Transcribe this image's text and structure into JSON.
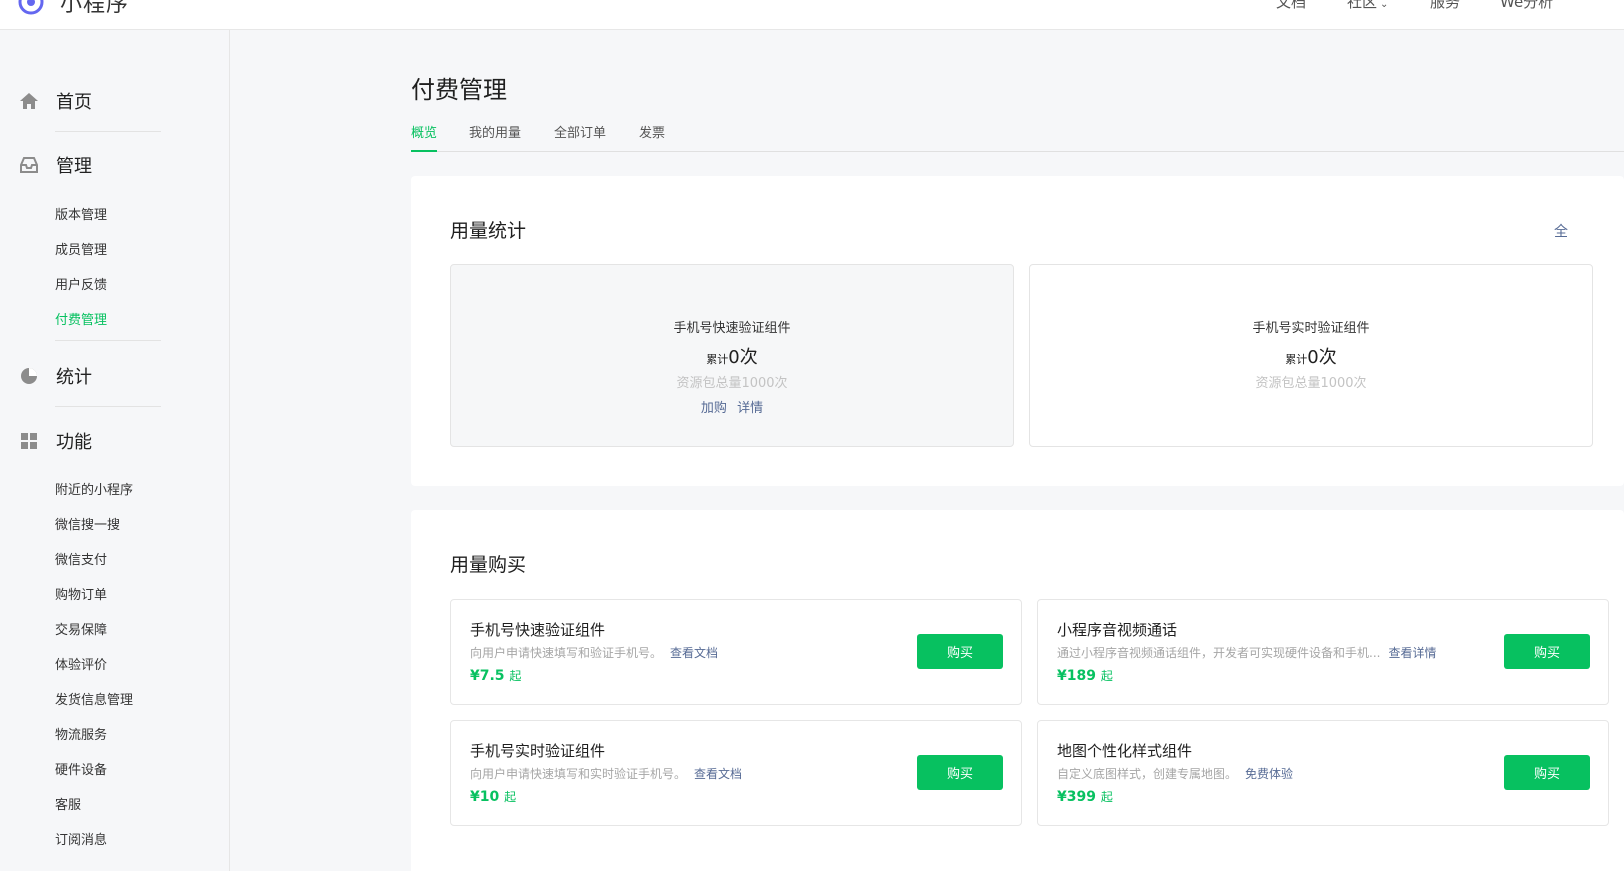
{
  "app": {
    "title": "小程序"
  },
  "topnav": [
    "文档",
    "社区",
    "服务",
    "We分析"
  ],
  "sidebar": {
    "groups": [
      {
        "label": "首页",
        "icon": "home-icon"
      },
      {
        "label": "管理",
        "icon": "inbox-icon",
        "items": [
          "版本管理",
          "成员管理",
          "用户反馈",
          "付费管理"
        ]
      },
      {
        "label": "统计",
        "icon": "pie-chart-icon"
      },
      {
        "label": "功能",
        "icon": "grid-icon",
        "items": [
          "附近的小程序",
          "微信搜一搜",
          "微信支付",
          "购物订单",
          "交易保障",
          "体验评价",
          "发货信息管理",
          "物流服务",
          "硬件设备",
          "客服",
          "订阅消息"
        ]
      }
    ],
    "active_item": "付费管理"
  },
  "page": {
    "title": "付费管理",
    "tabs": [
      "概览",
      "我的用量",
      "全部订单",
      "发票"
    ],
    "active_tab": "概览"
  },
  "usage": {
    "title": "用量统计",
    "link": "全",
    "cards": [
      {
        "name": "手机号快速验证组件",
        "prefix": "累计",
        "count": "0次",
        "total": "资源包总量1000次",
        "links": [
          "加购",
          "详情"
        ]
      },
      {
        "name": "手机号实时验证组件",
        "prefix": "累计",
        "count": "0次",
        "total": "资源包总量1000次"
      }
    ]
  },
  "purchase": {
    "title": "用量购买",
    "items": [
      {
        "name": "手机号快速验证组件",
        "desc": "向用户申请快速填写和验证手机号。",
        "link": "查看文档",
        "price": "¥7.5",
        "suffix": "起",
        "button": "购买"
      },
      {
        "name": "小程序音视频通话",
        "desc": "通过小程序音视频通话组件，开发者可实现硬件设备和手机...",
        "link": "查看详情",
        "price": "¥189",
        "suffix": "起",
        "button": "购买"
      },
      {
        "name": "手机号实时验证组件",
        "desc": "向用户申请快速填写和实时验证手机号。",
        "link": "查看文档",
        "price": "¥10",
        "suffix": "起",
        "button": "购买"
      },
      {
        "name": "地图个性化样式组件",
        "desc": "自定义底图样式，创建专属地图。",
        "link": "免费体验",
        "price": "¥399",
        "suffix": "起",
        "button": "购买"
      }
    ]
  },
  "colors": {
    "accent": "#07c160",
    "link": "#576b95"
  }
}
